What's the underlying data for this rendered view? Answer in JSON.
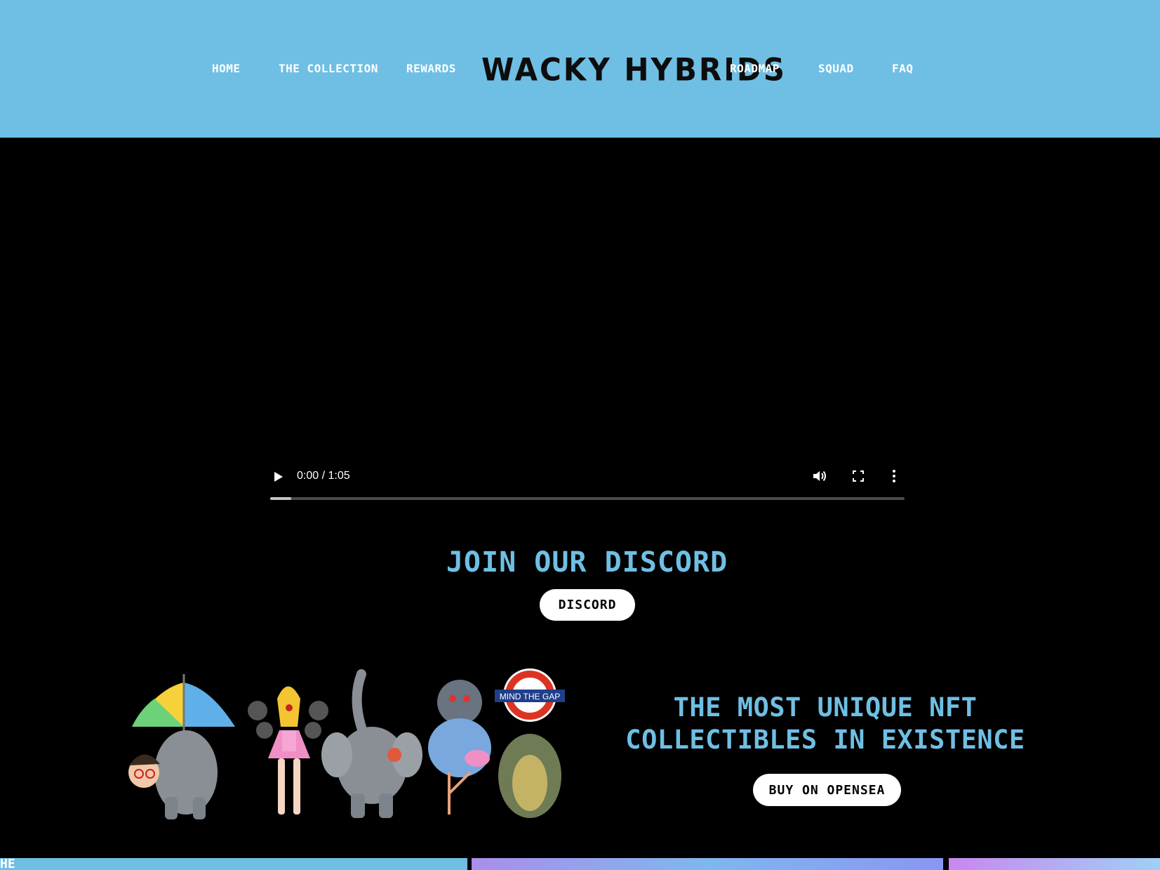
{
  "nav": {
    "home": "HOME",
    "collection": "THE COLLECTION",
    "rewards": "REWARDS",
    "logo": "WACKY HYBRIDS",
    "roadmap": "ROADMAP",
    "squad": "SQUAD",
    "faq": "FAQ"
  },
  "video": {
    "time": "0:00 / 1:05",
    "progress": 0.033
  },
  "discord": {
    "heading": "JOIN OUR DISCORD",
    "button": "DISCORD"
  },
  "hero": {
    "tagline_line1": "THE MOST UNIQUE NFT",
    "tagline_line2": "COLLECTIBLES IN EXISTENCE",
    "button": "BUY ON OPENSEA",
    "sign_text": "MIND THE GAP"
  },
  "bottom": {
    "strip_text": "HE"
  },
  "colors": {
    "accent": "#6fbfe4",
    "background": "#000000",
    "button": "#ffffff"
  }
}
